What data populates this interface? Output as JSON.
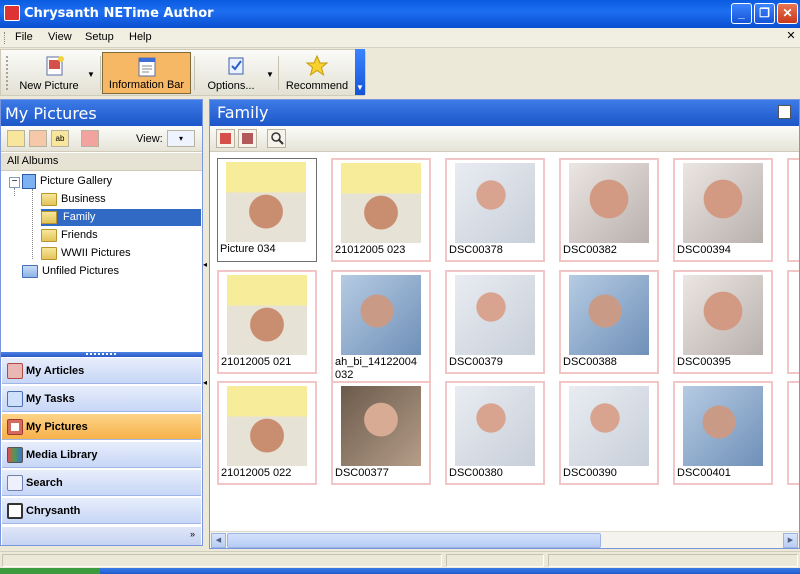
{
  "window": {
    "title": "Chrysanth NETime Author",
    "controls": [
      "minimize-icon",
      "restore-icon",
      "close-icon"
    ]
  },
  "menu": [
    "File",
    "View",
    "Setup",
    "Help"
  ],
  "toolbar": {
    "buttons": [
      {
        "label": "New Picture",
        "icon": "new-picture-icon",
        "dropdown": true
      },
      {
        "label": "Information Bar",
        "icon": "information-bar-icon",
        "active": true
      },
      {
        "label": "Options...",
        "icon": "options-icon",
        "dropdown": true
      },
      {
        "label": "Recommend",
        "icon": "star-icon"
      }
    ]
  },
  "left_panel": {
    "title": "My Pictures",
    "view_label": "View:",
    "all_albums": "All Albums",
    "tree": {
      "root": "Picture Gallery",
      "albums": [
        "Business",
        "Family",
        "Friends",
        "WWII Pictures"
      ],
      "selected": "Family",
      "unfiled": "Unfiled Pictures"
    },
    "nav": [
      {
        "label": "My Articles",
        "icon": "articles-icon",
        "color": "#d9534f"
      },
      {
        "label": "My Tasks",
        "icon": "tasks-icon",
        "color": "#5b8bd8"
      },
      {
        "label": "My Pictures",
        "icon": "pictures-icon",
        "color": "#c8493b",
        "active": true
      },
      {
        "label": "Media Library",
        "icon": "media-library-icon",
        "color": "#4a9a57"
      },
      {
        "label": "Search",
        "icon": "search-icon",
        "color": "#6f7fb0"
      },
      {
        "label": "Chrysanth",
        "icon": "chrysanth-icon",
        "color": "#333333"
      }
    ],
    "more": "»"
  },
  "right_panel": {
    "title": "Family",
    "pictures": [
      {
        "name": "Picture 034",
        "tone": "yellow-hat"
      },
      {
        "name": "21012005 023",
        "tone": "yellow-hat"
      },
      {
        "name": "DSC00378",
        "tone": "white"
      },
      {
        "name": "DSC00382",
        "tone": "skin"
      },
      {
        "name": "DSC00394",
        "tone": "skin"
      },
      {
        "name": "21012005 021",
        "tone": "yellow-hat"
      },
      {
        "name": "ah_bi_14122004 032",
        "tone": "blue"
      },
      {
        "name": "DSC00379",
        "tone": "white"
      },
      {
        "name": "DSC00388",
        "tone": "blue"
      },
      {
        "name": "DSC00395",
        "tone": "skin"
      },
      {
        "name": "21012005 022",
        "tone": "yellow-hat"
      },
      {
        "name": "DSC00377",
        "tone": "dark"
      },
      {
        "name": "DSC00380",
        "tone": "white"
      },
      {
        "name": "DSC00390",
        "tone": "white"
      },
      {
        "name": "DSC00401",
        "tone": "blue"
      }
    ]
  },
  "colors": {
    "title_bar": "#0a5be0",
    "panel_header": "#2c66d4",
    "active_nav": "#f7b14a",
    "selection": "#316ac5",
    "thumb_border": "#f2c6c6"
  }
}
